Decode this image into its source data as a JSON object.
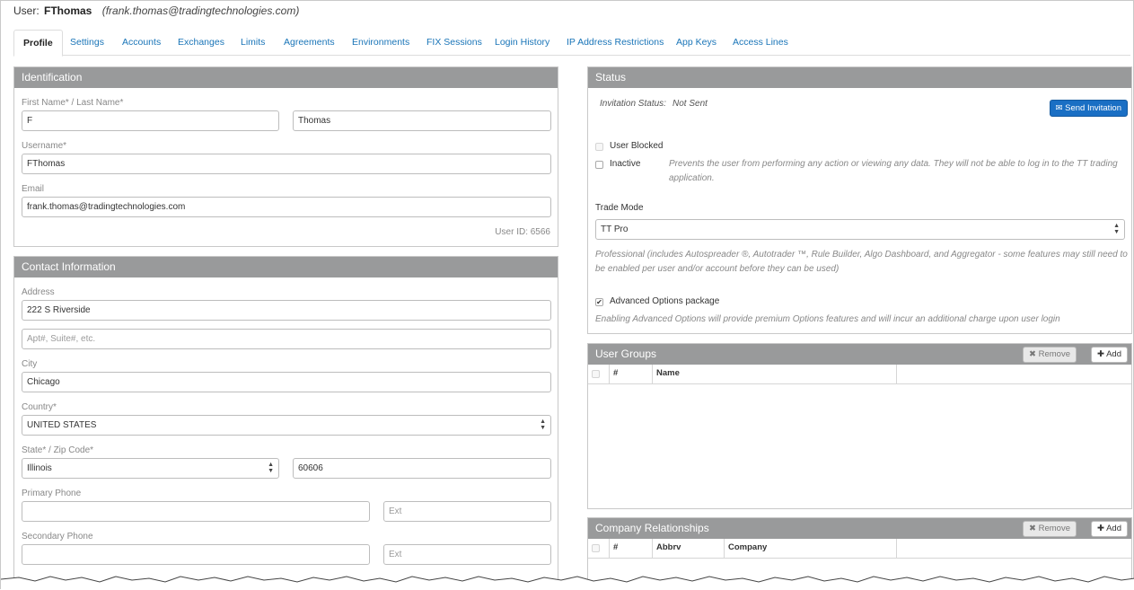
{
  "header": {
    "prefix": "User:",
    "username": "FThomas",
    "email": "(frank.thomas@tradingtechnologies.com)"
  },
  "tabs": [
    {
      "label": "Profile",
      "active": true
    },
    {
      "label": "Settings"
    },
    {
      "label": "Accounts"
    },
    {
      "label": "Exchanges"
    },
    {
      "label": "Limits"
    },
    {
      "label": "Agreements"
    },
    {
      "label": "Environments"
    },
    {
      "label": "FIX Sessions"
    },
    {
      "label": "Login History"
    },
    {
      "label": "IP Address Restrictions"
    },
    {
      "label": "App Keys"
    },
    {
      "label": "Access Lines"
    }
  ],
  "identification": {
    "title": "Identification",
    "name_label": "First Name* / Last Name*",
    "first_name": "F",
    "last_name": "Thomas",
    "username_label": "Username*",
    "username": "FThomas",
    "email_label": "Email",
    "email": "frank.thomas@tradingtechnologies.com",
    "user_id": "User ID: 6566"
  },
  "contact": {
    "title": "Contact Information",
    "address_label": "Address",
    "address": "222 S Riverside",
    "address2_placeholder": "Apt#, Suite#, etc.",
    "city_label": "City",
    "city": "Chicago",
    "country_label": "Country*",
    "country": "UNITED STATES",
    "state_zip_label": "State* / Zip Code*",
    "state": "Illinois",
    "zip": "60606",
    "primary_phone_label": "Primary Phone",
    "primary_phone": "",
    "ext_placeholder": "Ext",
    "secondary_phone_label": "Secondary Phone",
    "secondary_phone": ""
  },
  "status": {
    "title": "Status",
    "invitation_label": "Invitation Status:",
    "invitation_value": "Not Sent",
    "send_button": "Send Invitation",
    "user_blocked_label": "User Blocked",
    "user_blocked": false,
    "inactive_label": "Inactive",
    "inactive": false,
    "inactive_desc_1": "Prevents the user from performing any action or viewing any data. They will not be able to log in to the TT trading",
    "inactive_desc_2": "application.",
    "trade_mode_label": "Trade Mode",
    "trade_mode": "TT Pro",
    "trade_mode_desc_1": "Professional (includes Autospreader ®, Autotrader ™, Rule Builder, Algo Dashboard, and Aggregator - some features may still need to",
    "trade_mode_desc_2": "be enabled per user and/or account before they can be used)",
    "advanced_label": "Advanced Options package",
    "advanced": true,
    "advanced_desc": "Enabling Advanced Options will provide premium Options features and will incur an additional charge upon user login"
  },
  "user_groups": {
    "title": "User Groups",
    "remove_label": "Remove",
    "add_label": "Add",
    "columns": [
      "#",
      "Name"
    ]
  },
  "company_relationships": {
    "title": "Company Relationships",
    "remove_label": "Remove",
    "add_label": "Add",
    "columns": [
      "#",
      "Abbrv",
      "Company"
    ]
  },
  "colors": {
    "link": "#1a75b8",
    "panel_header": "#999a9b",
    "primary_button": "#1a6fc4"
  }
}
